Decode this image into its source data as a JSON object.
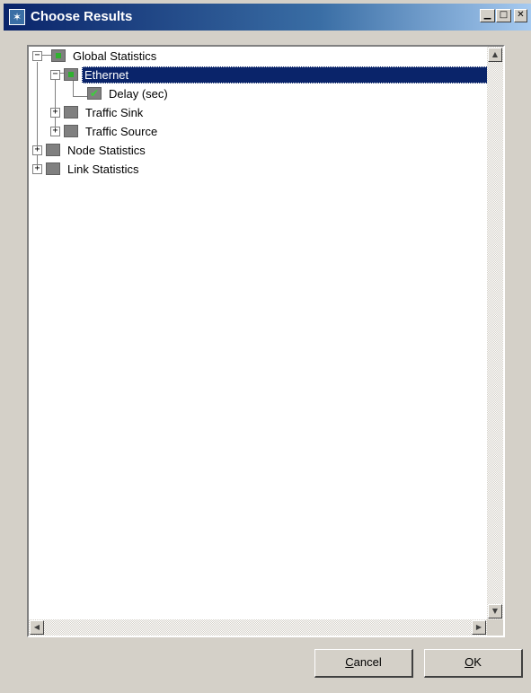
{
  "window": {
    "title": "Choose Results",
    "app_icon": "star-app-icon",
    "controls": [
      "minimize",
      "maximize",
      "close"
    ]
  },
  "tree": {
    "items": [
      {
        "label": "Global Statistics",
        "expander": "−",
        "icon": "green-stat-icon"
      },
      {
        "label": "Ethernet",
        "expander": "−",
        "icon": "green-stat-icon",
        "selected": true
      },
      {
        "label": "Delay (sec)",
        "icon": "checked-stat-icon",
        "checked": true
      },
      {
        "label": "Traffic Sink",
        "expander": "+",
        "icon": "gray-stat-icon"
      },
      {
        "label": "Traffic Source",
        "expander": "+",
        "icon": "gray-stat-icon"
      },
      {
        "label": "Node Statistics",
        "expander": "+",
        "icon": "gray-stat-icon"
      },
      {
        "label": "Link Statistics",
        "expander": "+",
        "icon": "gray-stat-icon"
      }
    ]
  },
  "buttons": {
    "cancel": {
      "accel": "C",
      "rest": "ancel"
    },
    "ok": {
      "accel": "O",
      "rest": "K"
    }
  },
  "colors": {
    "selection": "#0a246a",
    "titlebar": "#0a246a",
    "dialog": "#d4d0c8",
    "check": "#39d339"
  }
}
